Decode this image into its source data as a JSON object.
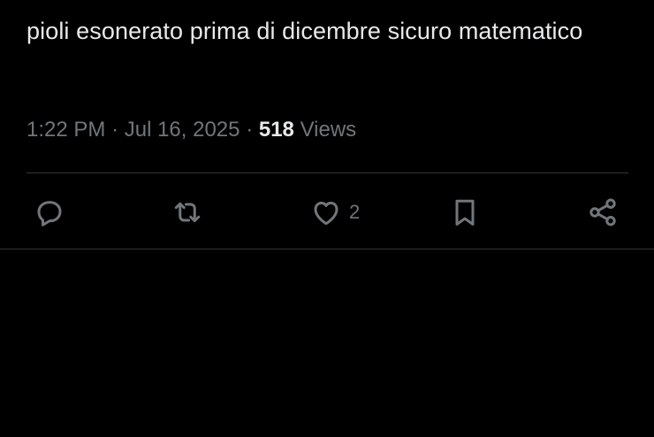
{
  "tweet": {
    "text": "pioli esonerato prima di dicembre sicuro matematico"
  },
  "meta": {
    "time": "1:22 PM",
    "separator": "·",
    "date": "Jul 16, 2025",
    "views_count": "518",
    "views_label": "Views"
  },
  "actions": {
    "reply": {
      "icon": "reply-icon",
      "count": ""
    },
    "repost": {
      "icon": "repost-icon",
      "count": ""
    },
    "like": {
      "icon": "heart-icon",
      "count": "2"
    },
    "bookmark": {
      "icon": "bookmark-icon",
      "count": ""
    },
    "share": {
      "icon": "share-icon",
      "count": ""
    }
  },
  "colors": {
    "background": "#000000",
    "text_primary": "#e7e9ea",
    "text_secondary": "#71767b",
    "divider": "#2f3336"
  }
}
